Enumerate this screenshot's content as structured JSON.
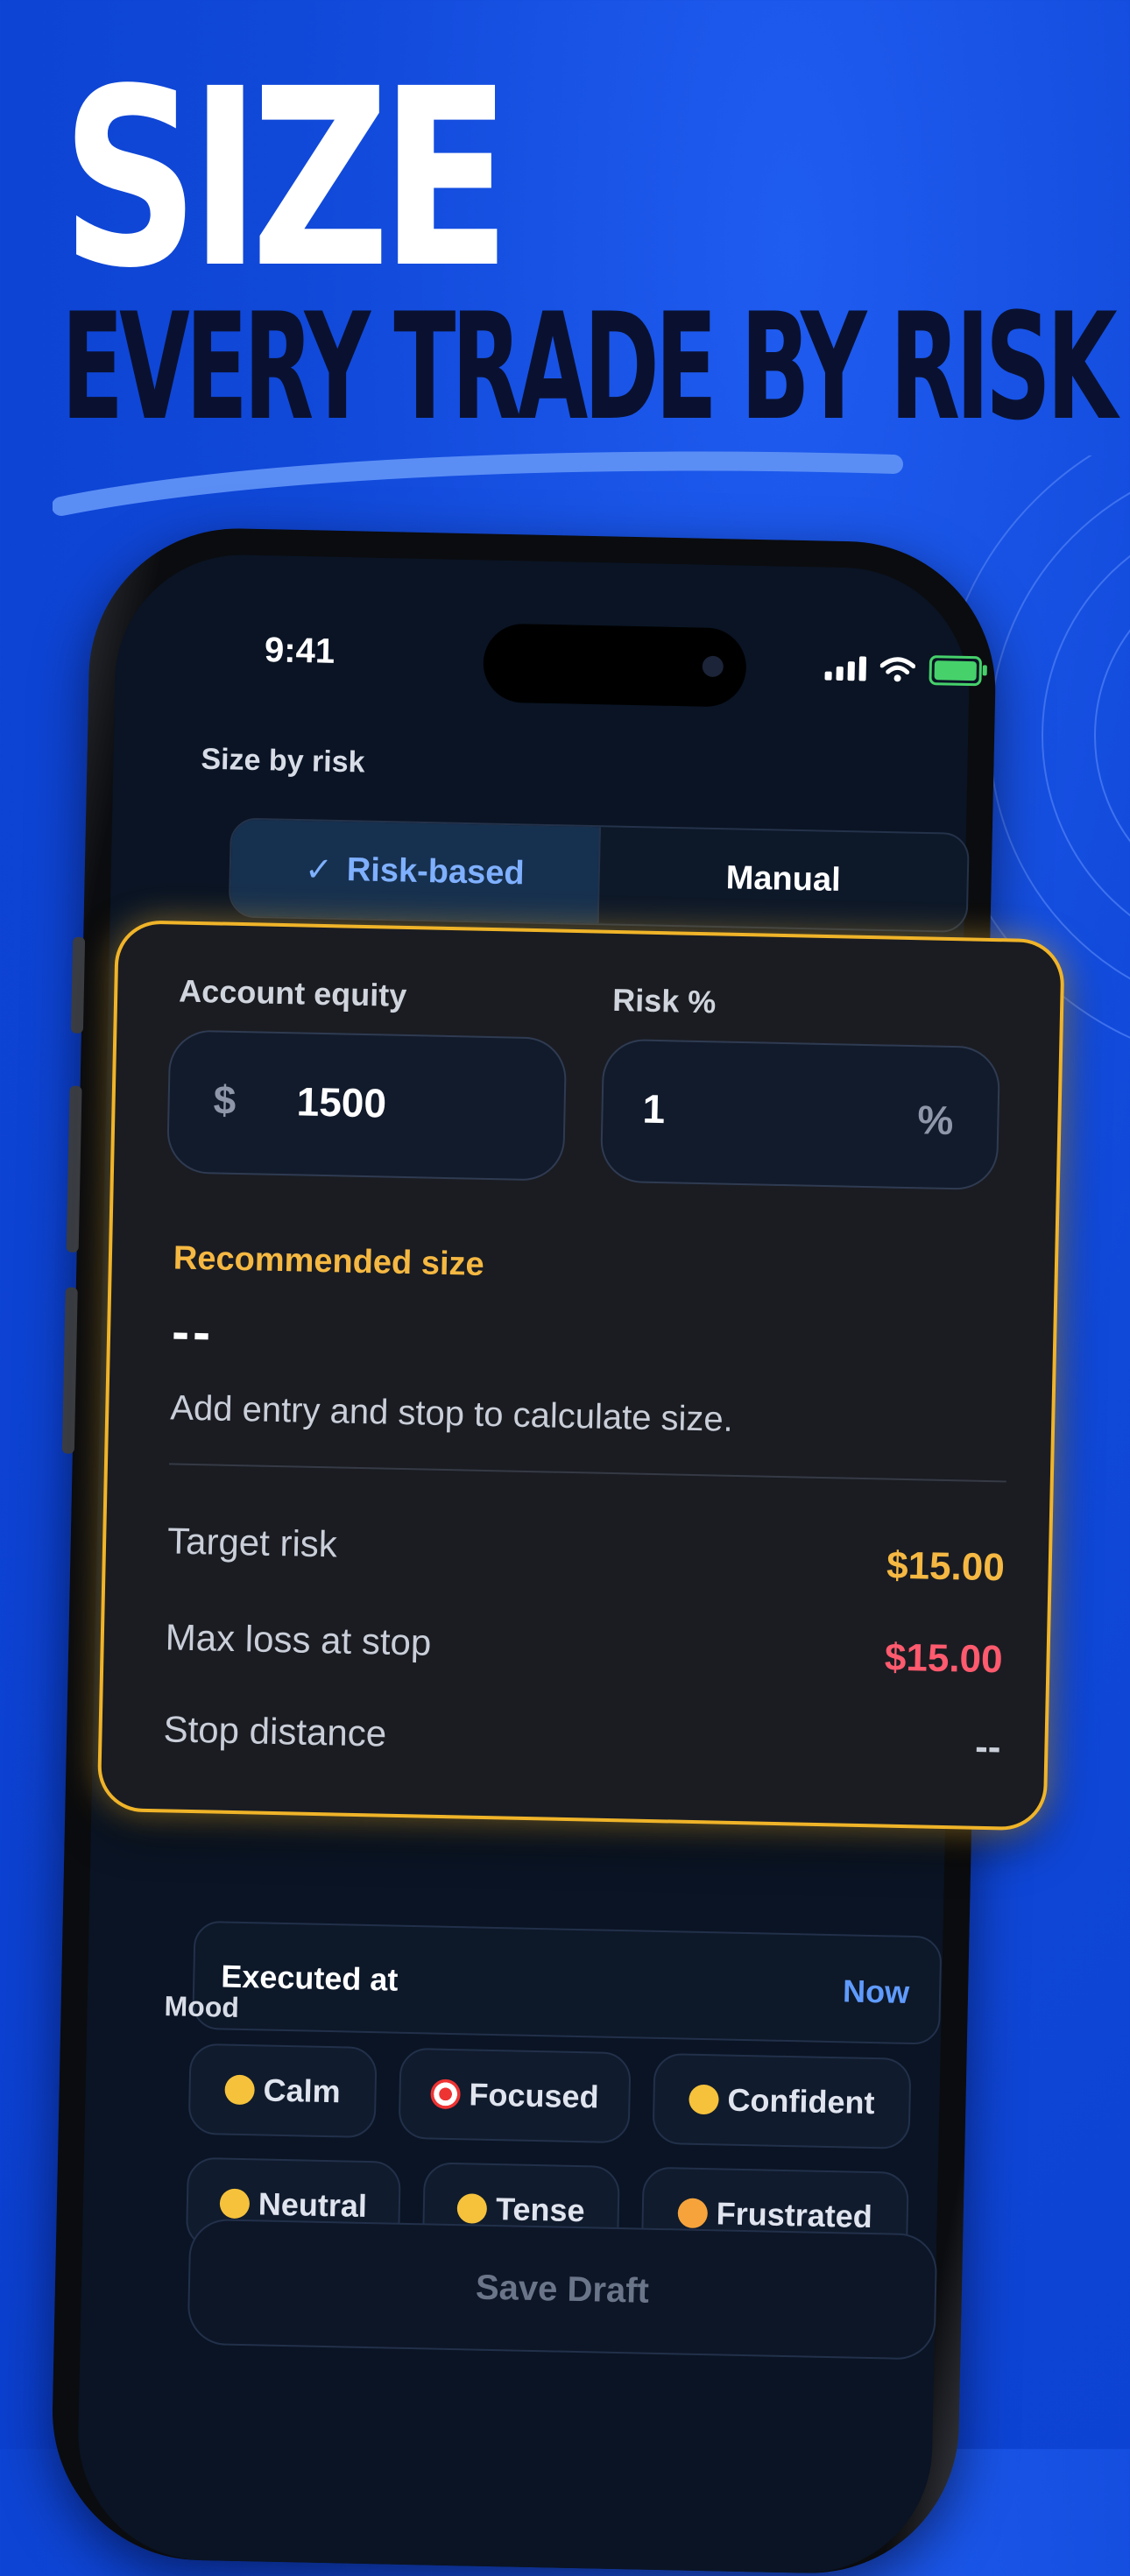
{
  "headline": {
    "line1": "SIZE",
    "line2": "EVERY TRADE BY RISK"
  },
  "status_bar": {
    "time": "9:41"
  },
  "section": {
    "title": "Size by risk"
  },
  "toggle": {
    "active_label": "Risk-based",
    "inactive_label": "Manual",
    "check_glyph": "✓"
  },
  "card": {
    "account_equity_label": "Account equity",
    "risk_percent_label": "Risk %",
    "equity_prefix": "$",
    "equity_value": "1500",
    "risk_value": "1",
    "risk_suffix": "%",
    "recommended_label": "Recommended size",
    "recommended_value": "--",
    "hint": "Add entry and stop to calculate size.",
    "rows": [
      {
        "label": "Target risk",
        "value": "$15.00",
        "color": "#f5b842"
      },
      {
        "label": "Max loss at stop",
        "value": "$15.00",
        "color": "#ff5a6e"
      },
      {
        "label": "Stop distance",
        "value": "--",
        "color": "#c9ced8"
      }
    ]
  },
  "executed": {
    "label": "Executed at",
    "value": "Now"
  },
  "mood": {
    "title": "Mood",
    "options": [
      "Calm",
      "Focused",
      "Confident",
      "Neutral",
      "Tense",
      "Frustrated"
    ]
  },
  "save_button": {
    "label": "Save Draft"
  },
  "colors": {
    "accent_blue": "#1048d8",
    "card_border": "#f0b429",
    "link": "#5f9bff"
  }
}
